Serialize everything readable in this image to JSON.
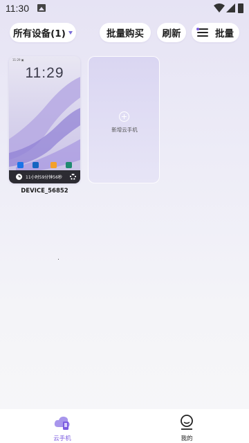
{
  "status_bar": {
    "time": "11:30"
  },
  "toolbar": {
    "devices_filter": "所有设备(1)",
    "batch_buy": "批量购买",
    "refresh": "刷新",
    "batch": "批量"
  },
  "devices": [
    {
      "name": "DEVICE_56852",
      "screen_clock": "11:29",
      "mini_status": "11:29 ▣",
      "remaining_time": "11小时59分钟56秒"
    }
  ],
  "add_card": {
    "label": "新增云手机"
  },
  "bottom_nav": {
    "items": [
      {
        "label": "云手机",
        "icon": "cloud-phone-icon",
        "active": true
      },
      {
        "label": "我的",
        "icon": "user-icon",
        "active": false
      }
    ]
  },
  "colors": {
    "accent": "#7c5ce0",
    "caret": "#7a6cd8",
    "footer_bar": "#1e1e23",
    "background": "#e6e3f4"
  }
}
